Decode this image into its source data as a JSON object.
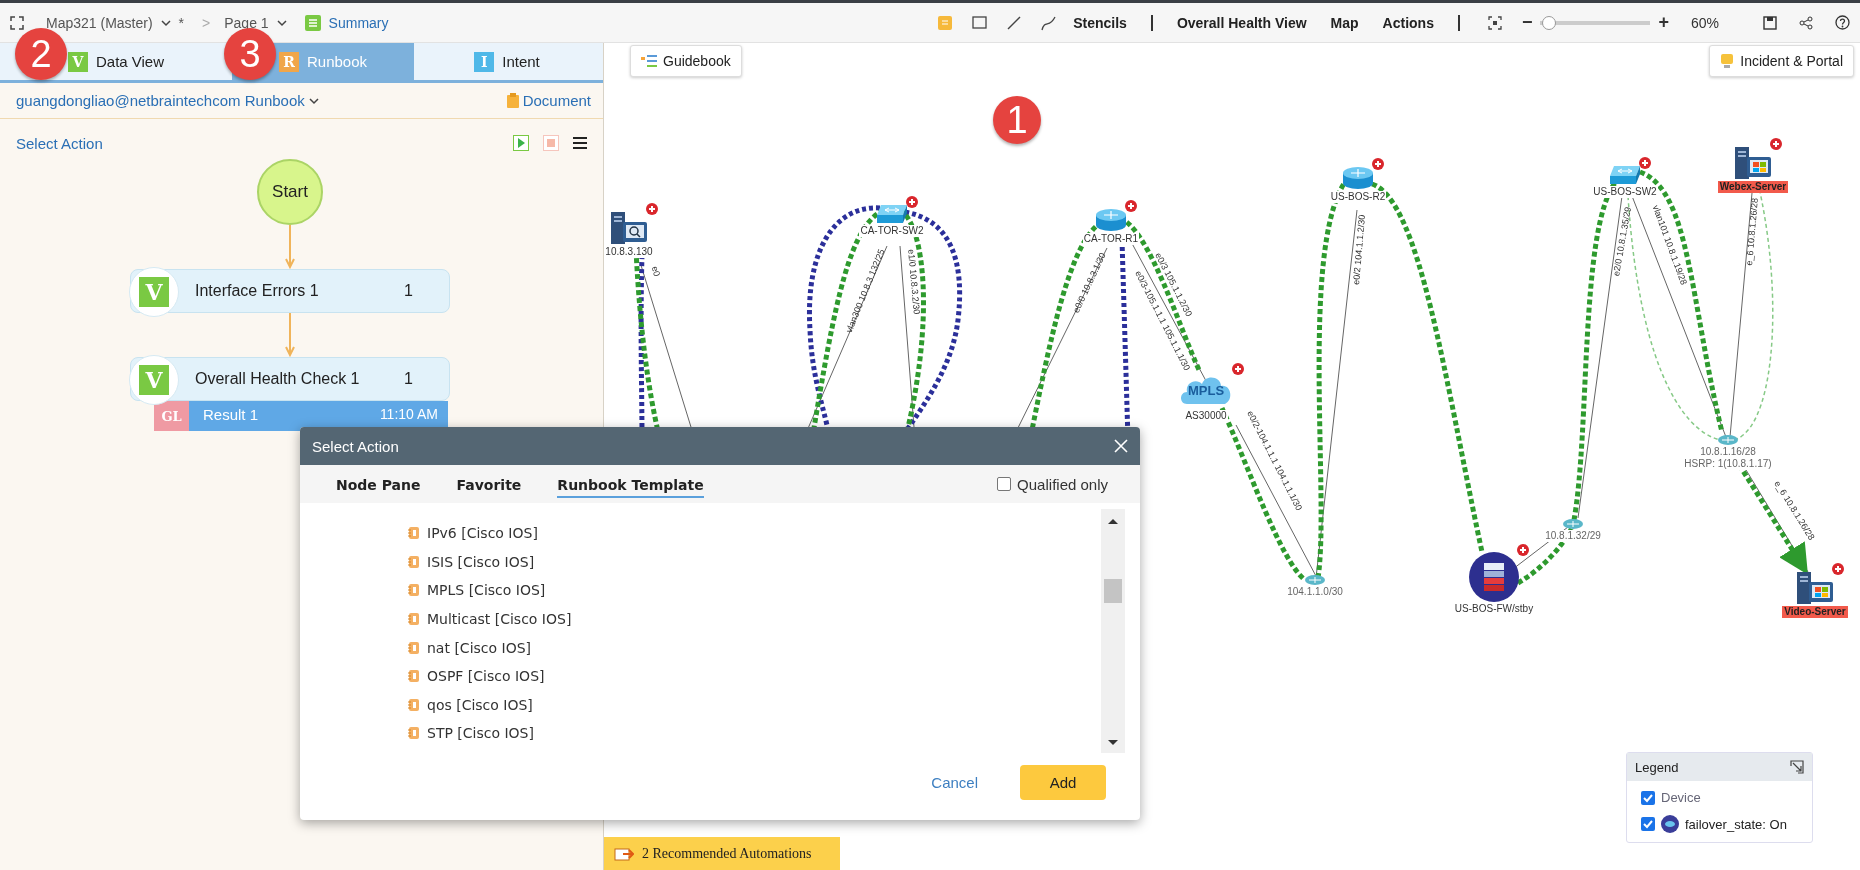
{
  "toolbar": {
    "map_name": "Map321 (Master)",
    "modified": "*",
    "separator": ">",
    "page": "Page 1",
    "view": "Summary",
    "menus": [
      "Stencils",
      "Overall Health View",
      "Map",
      "Actions"
    ],
    "zoom": {
      "minus": "−",
      "plus": "+",
      "level": 0.07,
      "reading": "60%"
    }
  },
  "step_markers": [
    "1",
    "2",
    "3"
  ],
  "left_panel": {
    "tabs": [
      {
        "kind": "dataview",
        "icon_letter": "V",
        "label": "Data View",
        "selected": false
      },
      {
        "kind": "runbook",
        "icon_letter": "R",
        "label": "Runbook",
        "selected": true
      },
      {
        "kind": "intent",
        "icon_letter": "I",
        "label": "Intent",
        "selected": false
      }
    ],
    "account": "guangdongliao@netbraintechcom Runbook",
    "document": "Document",
    "select_action": "Select Action",
    "flow": {
      "start": "Start",
      "nodes": [
        {
          "icon_letter": "V",
          "title": "Interface Errors 1",
          "count": "1"
        },
        {
          "icon_letter": "V",
          "title": "Overall Health Check 1",
          "count": "1"
        }
      ],
      "result": {
        "tag": "GL",
        "title": "Result 1",
        "time": "11:10 AM"
      }
    }
  },
  "map": {
    "guidebook": "Guidebook",
    "incident_portal": "Incident & Portal",
    "nodes": [
      {
        "label": "10.8.3.130",
        "kind": "probe",
        "alert": false
      },
      {
        "label": "CA-TOR-SW2",
        "kind": "switch",
        "alert": false
      },
      {
        "label": "CA-TOR-R1",
        "kind": "router",
        "alert": false
      },
      {
        "label": "AS30000",
        "kind": "cloud",
        "icon_text": "MPLS",
        "alert": false
      },
      {
        "label": "US-BOS-R2",
        "kind": "router",
        "alert": false
      },
      {
        "label": "US-BOS-SW2",
        "kind": "switch",
        "alert": false
      },
      {
        "label": "Webex-Server",
        "kind": "appserver",
        "alert": true
      },
      {
        "label": "104.1.1.0/30",
        "kind": "subnet",
        "alert": false
      },
      {
        "label": "US-BOS-FW/stby",
        "kind": "firewall",
        "alert": false
      },
      {
        "label": "10.8.1.32/29",
        "kind": "subnet",
        "alert": false
      },
      {
        "label": "10.8.1.16/28",
        "sublabel": "HSRP: 1(10.8.1.17)",
        "kind": "subnet",
        "alert": false
      },
      {
        "label": "Video-Server",
        "kind": "appserver",
        "alert": true
      }
    ],
    "link_labels": [
      "e0",
      "vlan300 10.8.3.132/25",
      "e1/0 10.8.3.2/30",
      "e0/0 10.8.3.1/30",
      "e0/3 105.1.1.2/30",
      "e0/3-105.1.1.1 105.1.1.1/30",
      "e0/2-104.1.1.1 104.1.1.1/30",
      "e0/2 104.1.1.2/30",
      "e2/0 10.8.1.35/29",
      "vlan101 10.8.1.19/28",
      "e_6 10.8.1.26/28",
      "e_6 10.8.1.26/28"
    ],
    "legend": {
      "title": "Legend",
      "items": [
        {
          "kind": "plain",
          "label": "Device",
          "checked": true
        },
        {
          "kind": "icon",
          "label": "failover_state: On",
          "checked": true
        }
      ]
    },
    "automations": "2 Recommended Automations"
  },
  "dialog": {
    "title": "Select Action",
    "tabs": [
      {
        "label": "Node Pane",
        "selected": false
      },
      {
        "label": "Favorite",
        "selected": false
      },
      {
        "label": "Runbook Template",
        "selected": true
      }
    ],
    "qualified_only": {
      "label": "Qualified only",
      "checked": false
    },
    "items": [
      "IPv6 [Cisco IOS]",
      "ISIS [Cisco IOS]",
      "MPLS [Cisco IOS]",
      "Multicast [Cisco IOS]",
      "nat [Cisco IOS]",
      "OSPF [Cisco IOS]",
      "qos [Cisco IOS]",
      "STP [Cisco IOS]"
    ],
    "cancel": "Cancel",
    "add": "Add"
  }
}
